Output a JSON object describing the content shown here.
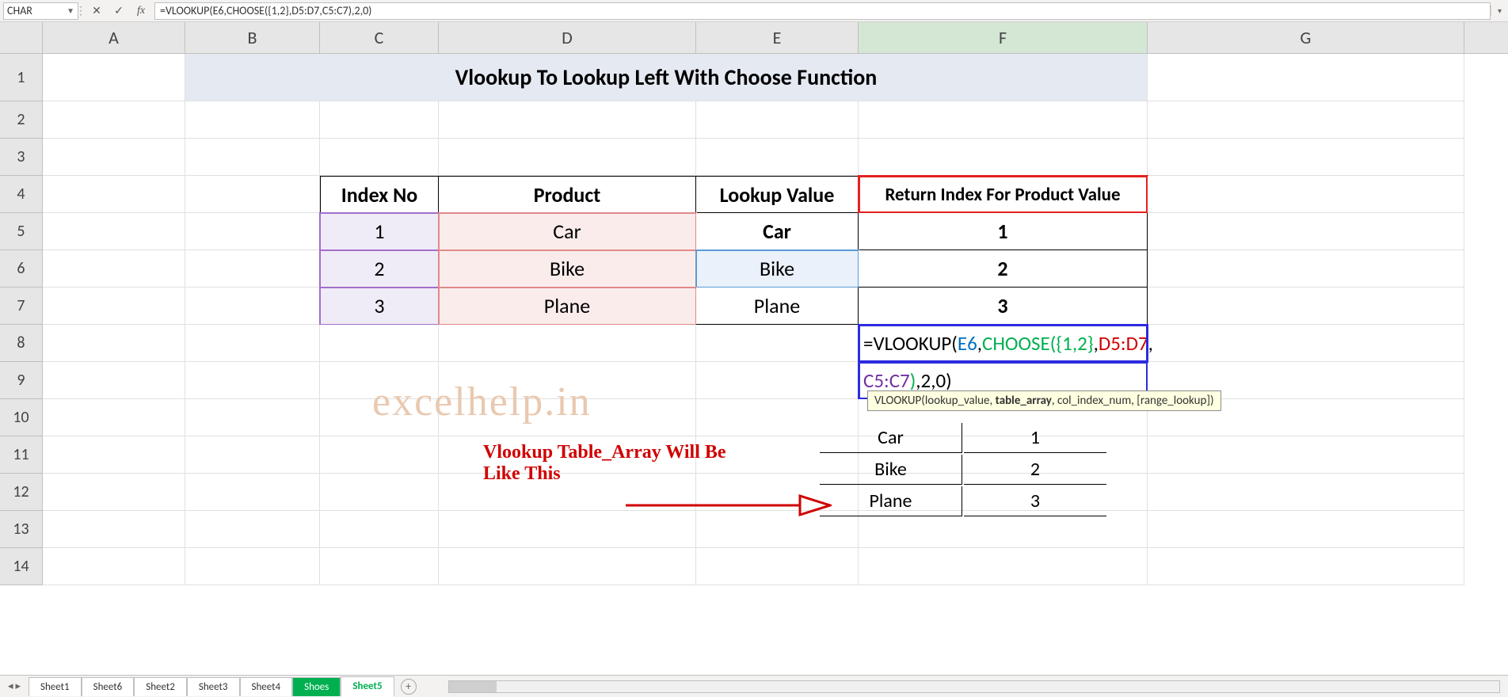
{
  "namebox": {
    "value": "CHAR"
  },
  "formula_bar": {
    "text": "=VLOOKUP(E6,CHOOSE({1,2},D5:D7,C5:C7),2,0)"
  },
  "fb_icons": {
    "cancel": "✕",
    "enter": "✓",
    "fx": "fx"
  },
  "columns": [
    "A",
    "B",
    "C",
    "D",
    "E",
    "F",
    "G"
  ],
  "rows": [
    "1",
    "2",
    "3",
    "4",
    "5",
    "6",
    "7",
    "8",
    "9",
    "10",
    "11",
    "12",
    "13",
    "14"
  ],
  "title": "Vlookup To Lookup Left With Choose Function",
  "table": {
    "headers": {
      "c": "Index No",
      "d": "Product",
      "e": "Lookup Value",
      "f": "Return Index For Product Value"
    },
    "rows": [
      {
        "c": "1",
        "d": "Car",
        "e": "Car",
        "f": "1"
      },
      {
        "c": "2",
        "d": "Bike",
        "e": "Bike",
        "f": "2"
      },
      {
        "c": "3",
        "d": "Plane",
        "e": "Plane",
        "f": "3"
      }
    ]
  },
  "formula_cell": {
    "p1": "=VLOOKUP(",
    "p2_arg1": "E6",
    "p3": ",",
    "p4_fn": "CHOOSE(",
    "p5_arr": "{1,2}",
    "p6": ",",
    "p7_r1": "D5:D7",
    "p8": ",",
    "line2_p1": "C5:C7",
    "line2_p2": ")",
    "line2_p3": ",2,0)"
  },
  "tooltip": {
    "pre": "VLOOKUP(lookup_value, ",
    "bold": "table_array",
    "post": ", col_index_num, [range_lookup])"
  },
  "watermark": "excelhelp.in",
  "annotation": {
    "line1": "Vlookup Table_Array Will Be",
    "line2": "Like This"
  },
  "mini_table": [
    {
      "a": "Car",
      "b": "1"
    },
    {
      "a": "Bike",
      "b": "2"
    },
    {
      "a": "Plane",
      "b": "3"
    }
  ],
  "sheet_tabs": [
    "Sheet1",
    "Sheet6",
    "Sheet2",
    "Sheet3",
    "Sheet4",
    "Shoes",
    "Sheet5"
  ],
  "addsheet": "+"
}
